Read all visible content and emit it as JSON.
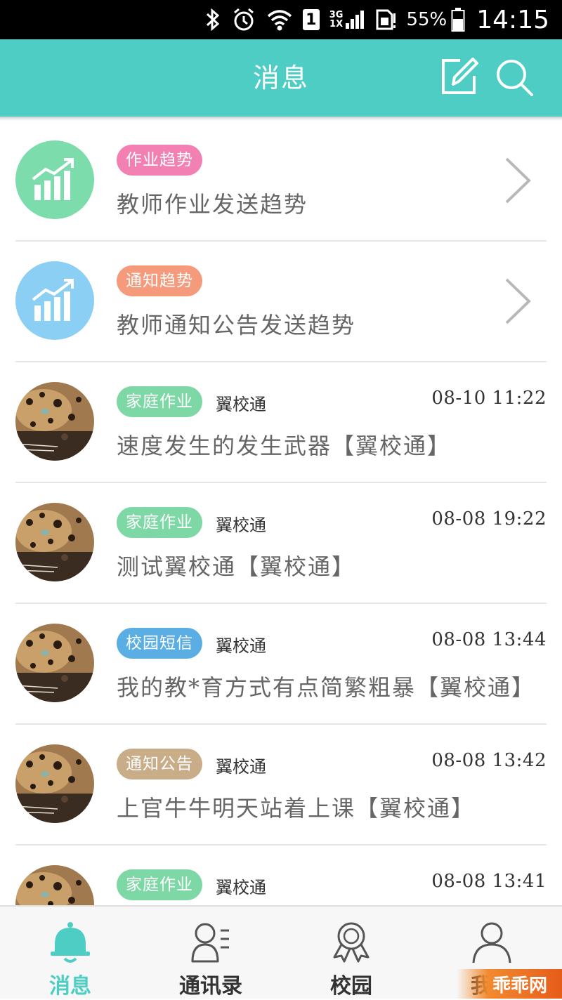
{
  "status_bar": {
    "network_top": "3G",
    "network_bottom": "1X",
    "sim_label": "1",
    "battery_percent": "55%",
    "time": "14:15"
  },
  "header": {
    "title": "消息"
  },
  "messages": [
    {
      "kind": "trend",
      "tag": "作业趋势",
      "tag_color": "#f280b3",
      "avatar_color": "#7ddcac",
      "text": "教师作业发送趋势"
    },
    {
      "kind": "trend",
      "tag": "通知趋势",
      "tag_color": "#f69a7c",
      "avatar_color": "#8ccff5",
      "text": "教师通知公告发送趋势"
    },
    {
      "kind": "message",
      "tag": "家庭作业",
      "tag_color": "#7dd8a6",
      "sender": "翼校通",
      "time": "08-10 11:22",
      "text": "速度发生的发生武器【翼校通】"
    },
    {
      "kind": "message",
      "tag": "家庭作业",
      "tag_color": "#7dd8a6",
      "sender": "翼校通",
      "time": "08-08 19:22",
      "text": "测试翼校通【翼校通】"
    },
    {
      "kind": "message",
      "tag": "校园短信",
      "tag_color": "#5aaee3",
      "sender": "翼校通",
      "time": "08-08 13:44",
      "text": "我的教*育方式有点简繁粗暴【翼校通】"
    },
    {
      "kind": "message",
      "tag": "通知公告",
      "tag_color": "#c9ad88",
      "sender": "翼校通",
      "time": "08-08 13:42",
      "text": "上官牛牛明天站着上课【翼校通】"
    },
    {
      "kind": "message",
      "tag": "家庭作业",
      "tag_color": "#7dd8a6",
      "sender": "翼校通",
      "time": "08-08 13:41",
      "text": ""
    }
  ],
  "tabs": [
    {
      "label": "消息",
      "icon": "bell-icon",
      "active": true
    },
    {
      "label": "通讯录",
      "icon": "contacts-icon",
      "active": false
    },
    {
      "label": "校园",
      "icon": "award-ribbon-icon",
      "active": false
    },
    {
      "label": "我的",
      "icon": "person-icon",
      "active": false
    }
  ],
  "watermark": {
    "text": "乖乖网"
  },
  "colors": {
    "accent": "#4ecdc4",
    "status_bar": "#000000",
    "divider": "#e6e6e6"
  }
}
